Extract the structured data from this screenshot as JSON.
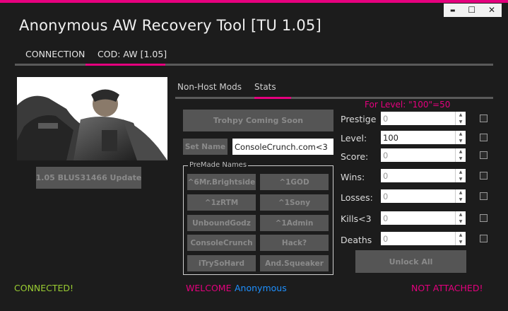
{
  "window": {
    "title": "Anonymous AW Recovery Tool [TU 1.05]",
    "controls": {
      "minimize": "▬",
      "maximize": "☐",
      "close": "✕"
    }
  },
  "top_tabs": [
    {
      "label": "CONNECTION"
    },
    {
      "label": "COD: AW [1.05]"
    }
  ],
  "left": {
    "image_alt": "Advanced Warfare soldier artwork",
    "update_button": "1.05 BLUS31466 Update"
  },
  "inner_tabs": [
    {
      "label": "Non-Host Mods"
    },
    {
      "label": "Stats"
    }
  ],
  "stats": {
    "hint": "For Level:  \"100\"=50",
    "trophy_button": "Trohpy Coming Soon",
    "set_name_button": "Set Name",
    "name_value": "ConsoleCrunch.com<3",
    "premade_label": "PreMade Names",
    "premade_names": [
      "^6Mr.Brightside",
      "^1GOD",
      "^1zRTM",
      "^1Sony",
      "UnboundGodz",
      "^1Admin",
      "ConsoleCrunch",
      "Hack?",
      "iTrySoHard",
      "And.Squeaker"
    ],
    "fields": [
      {
        "label": "Prestige",
        "value": "0"
      },
      {
        "label": "Level:",
        "value": "100"
      },
      {
        "label": "Score:",
        "value": "0"
      },
      {
        "label": "Wins:",
        "value": "0"
      },
      {
        "label": "Losses:",
        "value": "0"
      },
      {
        "label": "Kills<3",
        "value": "0"
      },
      {
        "label": "Deaths",
        "value": "0"
      }
    ],
    "unlock_button": "Unlock All"
  },
  "status": {
    "connected": "CONNECTED!",
    "welcome": "WELCOME",
    "user": "Anonymous",
    "attached": "NOT ATTACHED!"
  },
  "colors": {
    "accent": "#e5007e",
    "connected": "#9acd32",
    "user": "#1e90ff",
    "error": "#e5007e"
  }
}
